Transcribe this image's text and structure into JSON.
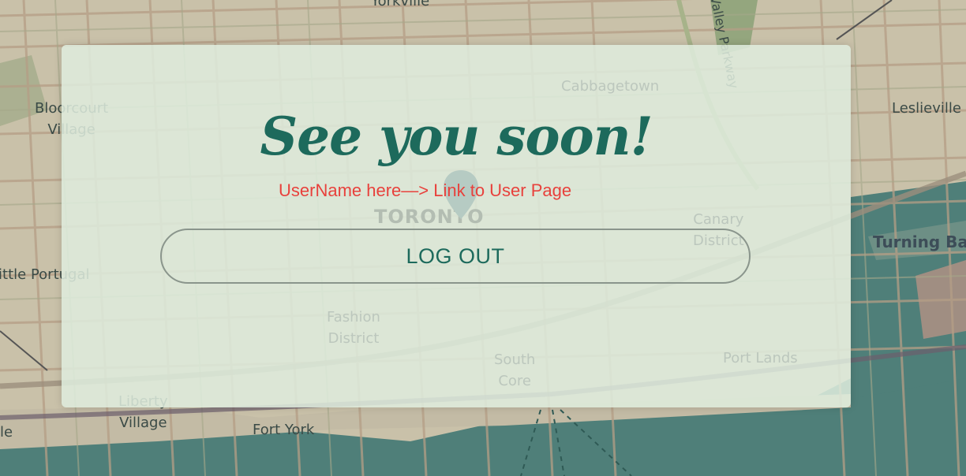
{
  "map": {
    "labels": {
      "yorkville": "Yorkville",
      "valley_parkway": "Valley Parkway",
      "cabbagetown": "Cabbagetown",
      "bloorcourt_village": "Bloorcourt\nVillage",
      "leslieville": "Leslieville",
      "toronto": "TORONTO",
      "canary_district": "Canary\nDistrict",
      "turning_basin": "Turning Basin",
      "little_portugal": "Little Portugal",
      "fashion_district": "Fashion\nDistrict",
      "south_core": "South\nCore",
      "port_lands": "Port Lands",
      "liberty_village": "Liberty\nVillage",
      "fort_york": "Fort York",
      "edge_left": "le"
    }
  },
  "modal": {
    "title": "See you soon!",
    "user_link": "UserName here—> Link to User Page",
    "logout_label": "LOG OUT"
  },
  "colors": {
    "title": "#1d6a5c",
    "link": "#e8413c",
    "button_text": "#1d6a5c",
    "water": "#4f7f79"
  }
}
